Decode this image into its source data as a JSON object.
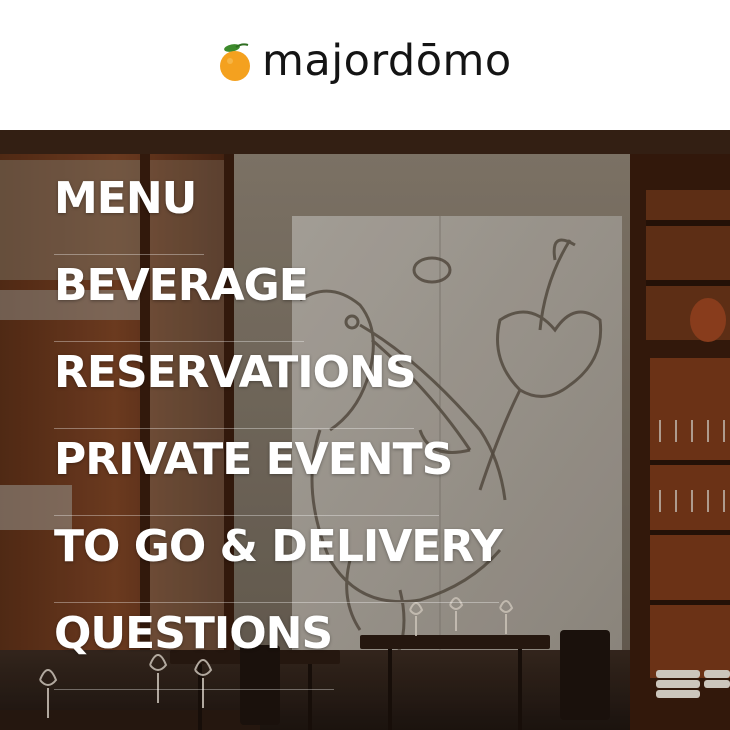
{
  "brand": {
    "name": "majordōmo",
    "logo_icon": "orange-fruit-icon",
    "colors": {
      "orange": "#f4a11f",
      "leaf": "#3d8a2c",
      "text": "#141414"
    }
  },
  "nav": {
    "items": [
      {
        "label": "MENU"
      },
      {
        "label": "BEVERAGE"
      },
      {
        "label": "RESERVATIONS"
      },
      {
        "label": "PRIVATE EVENTS"
      },
      {
        "label": "TO GO & DELIVERY"
      },
      {
        "label": "QUESTIONS"
      }
    ],
    "text_color": "#ffffff"
  },
  "hero": {
    "image": "restaurant-dining-room-with-mural"
  }
}
